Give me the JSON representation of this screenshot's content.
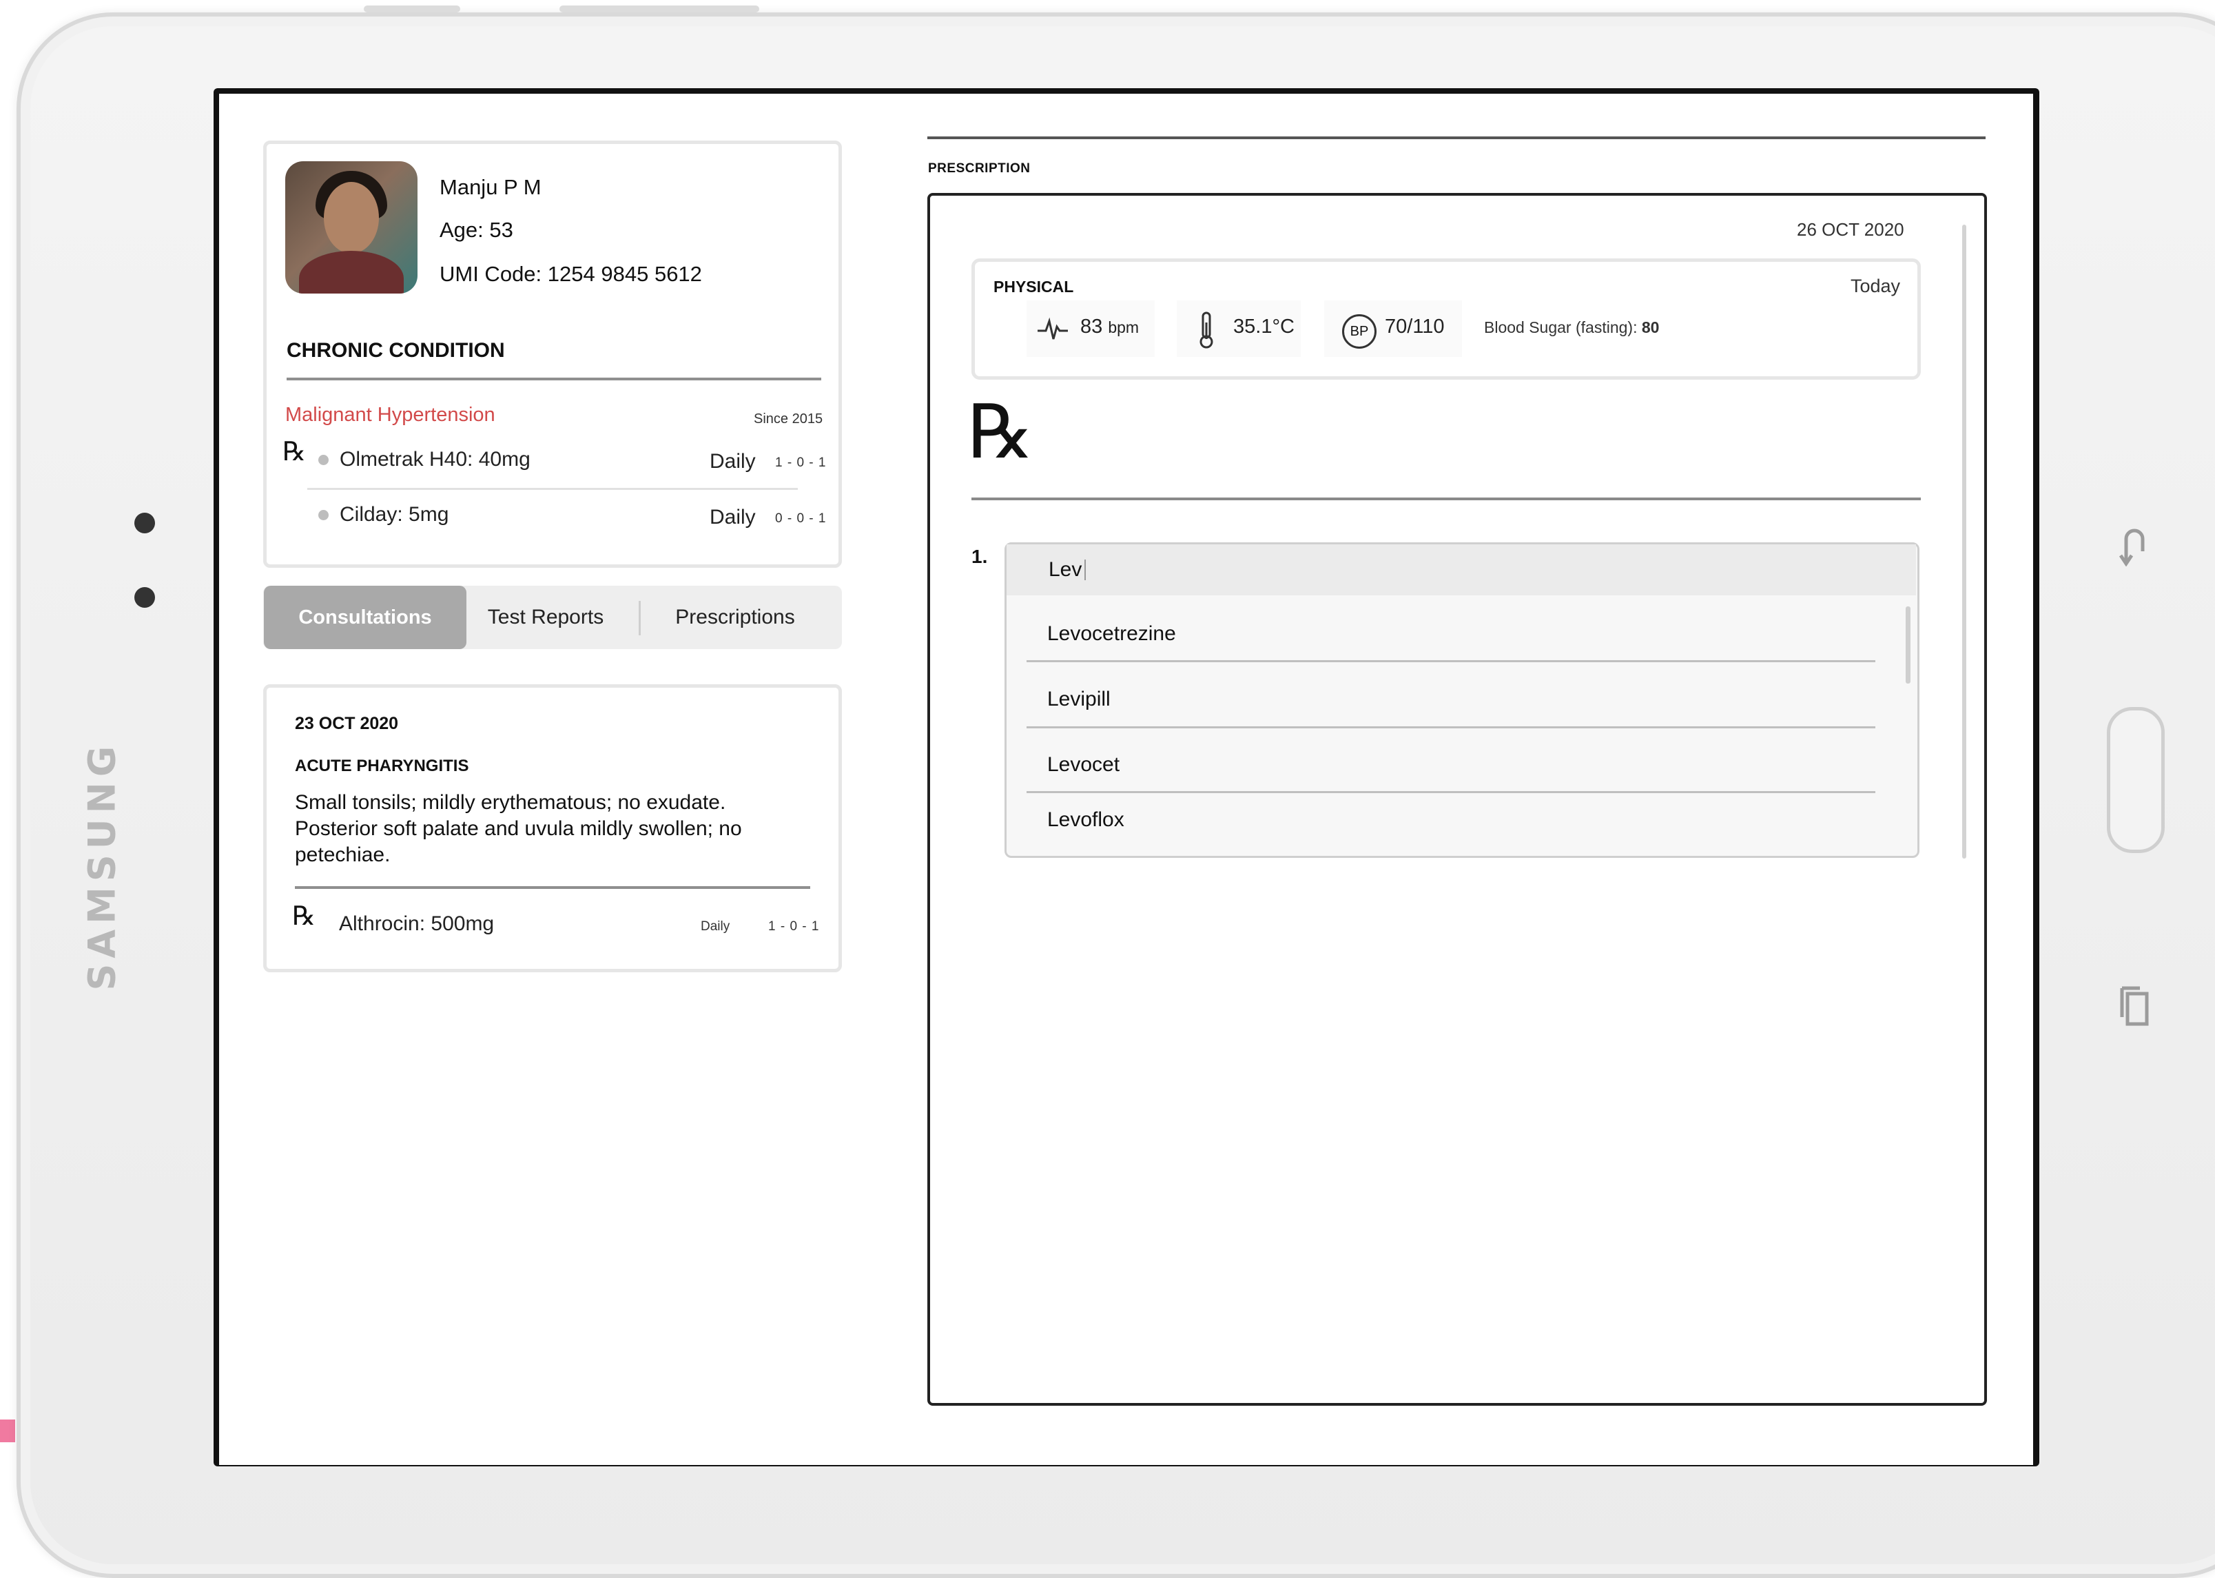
{
  "device": {
    "brand": "SAMSUNG"
  },
  "patient": {
    "name": "Manju P M",
    "age_label": "Age:",
    "age": "53",
    "umi_label": "UMI Code:",
    "umi": "1254 9845 5612"
  },
  "chronic": {
    "title": "CHRONIC CONDITION",
    "condition": "Malignant Hypertension",
    "since": "Since 2015",
    "meds": [
      {
        "name": "Olmetrak H40: 40mg",
        "freq": "Daily",
        "dose": "1 - 0 - 1"
      },
      {
        "name": "Cilday: 5mg",
        "freq": "Daily",
        "dose": "0 - 0 - 1"
      }
    ]
  },
  "tabs": [
    {
      "label": "Consultations",
      "active": true
    },
    {
      "label": "Test Reports",
      "active": false
    },
    {
      "label": "Prescriptions",
      "active": false
    }
  ],
  "consultation": {
    "date": "23 OCT 2020",
    "diagnosis": "ACUTE PHARYNGITIS",
    "notes": "Small tonsils; mildly erythematous; no exudate. Posterior soft palate and uvula mildly swollen; no petechiae.",
    "med": {
      "name": "Althrocin: 500mg",
      "freq": "Daily",
      "dose": "1 - 0 - 1"
    }
  },
  "prescription": {
    "label": "PRESCRIPTION",
    "date": "26 OCT 2020",
    "rx_symbol": "℞",
    "physical": {
      "title": "PHYSICAL",
      "when": "Today",
      "pulse_value": "83",
      "pulse_unit": "bpm",
      "temperature": "35.1°C",
      "bp_badge": "BP",
      "bp": "70/110",
      "sugar_label": "Blood Sugar (fasting):",
      "sugar_value": "80"
    },
    "item_number": "1.",
    "search_value": "Lev",
    "suggestions": [
      "Levocetrezine",
      "Levipill",
      "Levocet",
      "Levoflox"
    ]
  },
  "icons": [
    "heart-rate-icon",
    "thermometer-icon",
    "rx-icon",
    "back-key-icon",
    "recent-apps-key-icon"
  ],
  "colors": {
    "condition": "#d24a4a",
    "active_tab": "#a9a9a9",
    "accent_pink": "#f07aa0"
  }
}
